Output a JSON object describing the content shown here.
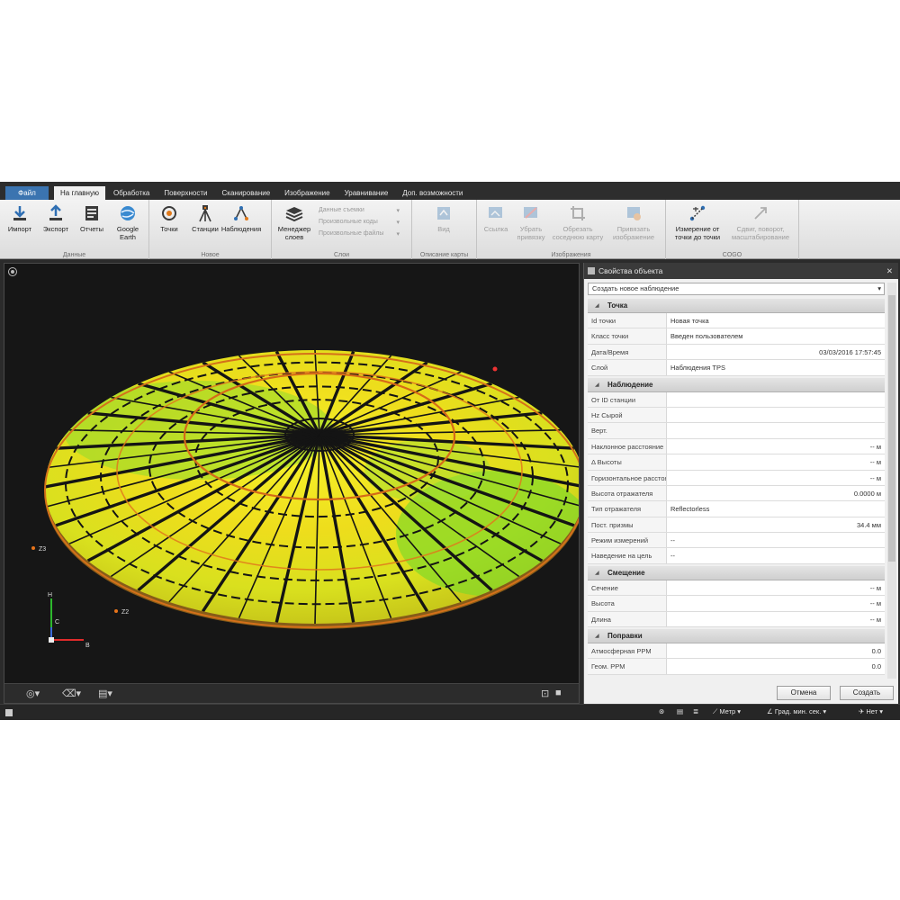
{
  "menu": {
    "file": "Файл",
    "tabs": [
      "На главную",
      "Обработка",
      "Поверхности",
      "Сканирование",
      "Изображение",
      "Уравнивание",
      "Доп. возможности"
    ],
    "active_tab": "На главную"
  },
  "ribbon": {
    "data_group": {
      "label": "Данные",
      "buttons": [
        "Импорт",
        "Экспорт",
        "Отчеты",
        "Google\nEarth"
      ]
    },
    "new_group": {
      "label": "Новое",
      "buttons": [
        "Точки",
        "Станции",
        "Наблюдения"
      ]
    },
    "layer_group": {
      "label": "Слои",
      "manager": "Менеджер\nслоев",
      "items": [
        "Данные съемки",
        "Произвольные коды",
        "Произвольные файлы"
      ]
    },
    "snap_group": {
      "label": "Описание карты",
      "button": "Вид"
    },
    "image_group": {
      "label": "Изображения",
      "buttons": [
        "Ссылка",
        "Убрать\nпривязку",
        "Обрезать\nсоседнюю карту",
        "Привязать\nизображение"
      ]
    },
    "cogo_group": {
      "label": "COGO",
      "buttons": [
        "Измерение от\nточки до точки",
        "Сдвиг, поворот,\nмасштабирование"
      ]
    }
  },
  "viewport": {
    "labels": {
      "z3": "Z3",
      "z2": "Z2",
      "axis_h": "H",
      "axis_c": "C",
      "axis_b": "B"
    },
    "colors": {
      "bg": "#161616",
      "yellow": "#f2ef1c",
      "green": "#7bd92a",
      "orange": "#e8741a",
      "dark": "#141414"
    }
  },
  "panel": {
    "title": "Свойства объекта",
    "combo": "Создать новое наблюдение",
    "sections": {
      "point": {
        "title": "Точка",
        "rows": [
          {
            "k": "Id точки",
            "v": "Новая точка"
          },
          {
            "k": "Класс точки",
            "v": "Введен пользователем"
          },
          {
            "k": "Дата/Время",
            "v": "",
            "r": "03/03/2016 17:57:45"
          },
          {
            "k": "Слой",
            "v": "Наблюдения TPS"
          }
        ]
      },
      "observation": {
        "title": "Наблюдение",
        "rows": [
          {
            "k": "От ID станции",
            "v": ""
          },
          {
            "k": "Hz Сырой",
            "v": ""
          },
          {
            "k": "Верт.",
            "v": ""
          },
          {
            "k": "Наклонное расстояние",
            "v": "",
            "r": "-- м"
          },
          {
            "k": "Δ Высоты",
            "v": "",
            "r": "-- м"
          },
          {
            "k": "Горизонтальное расстояние",
            "v": "",
            "r": "-- м"
          },
          {
            "k": "Высота отражателя",
            "v": "",
            "r": "0.0000 м"
          },
          {
            "k": "Тип отражателя",
            "v": "Reflectorless"
          },
          {
            "k": "Пост. призмы",
            "v": "",
            "r": "34.4 мм"
          },
          {
            "k": "Режим измерений",
            "v": "--"
          },
          {
            "k": "Наведение на цель",
            "v": "--"
          }
        ]
      },
      "offset": {
        "title": "Смещение",
        "rows": [
          {
            "k": "Сечение",
            "v": "",
            "r": "-- м"
          },
          {
            "k": "Высота",
            "v": "",
            "r": "-- м"
          },
          {
            "k": "Длина",
            "v": "",
            "r": "-- м"
          }
        ]
      },
      "corrections": {
        "title": "Поправки",
        "rows": [
          {
            "k": "Атмосферная PPM",
            "v": "",
            "r": "0.0"
          },
          {
            "k": "Геом. PPM",
            "v": "",
            "r": "0.0"
          }
        ]
      }
    },
    "cancel": "Отмена",
    "create": "Создать"
  },
  "status": {
    "unit": "Метр",
    "angle": "Град. мин. сек.",
    "none": "Нет"
  }
}
